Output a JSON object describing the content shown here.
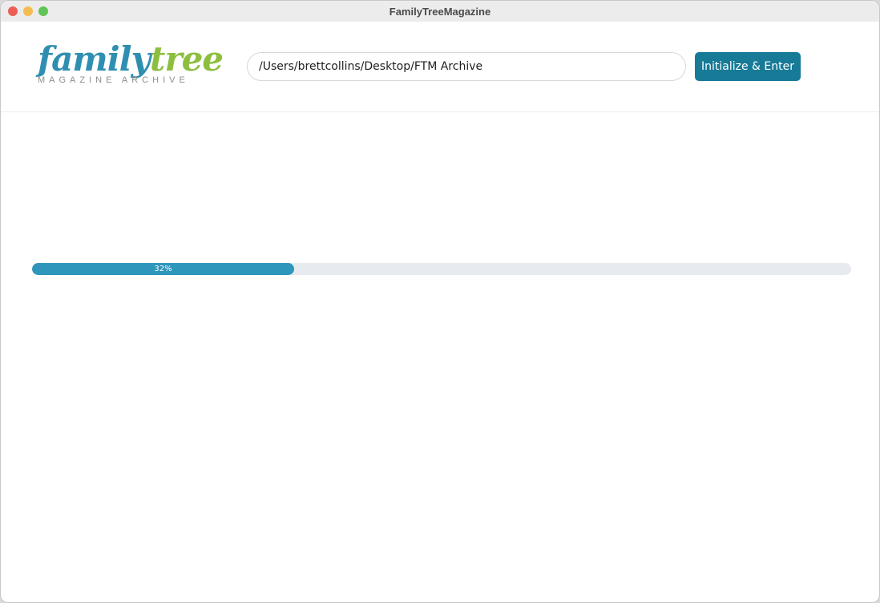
{
  "window": {
    "title": "FamilyTreeMagazine"
  },
  "logo": {
    "word_part1": "family",
    "word_part2": "tree",
    "subtitle": "MAGAZINE ARCHIVE",
    "color_family": "#2f8fb0",
    "color_tree": "#8cbf3f"
  },
  "path_input": {
    "value": "/Users/brettcollins/Desktop/FTM Archive",
    "placeholder": ""
  },
  "buttons": {
    "enter_label": "Initialize & Enter",
    "color": "#177a97"
  },
  "progress": {
    "fraction": 0.32,
    "label": "32%",
    "color": "#2e95bb"
  }
}
